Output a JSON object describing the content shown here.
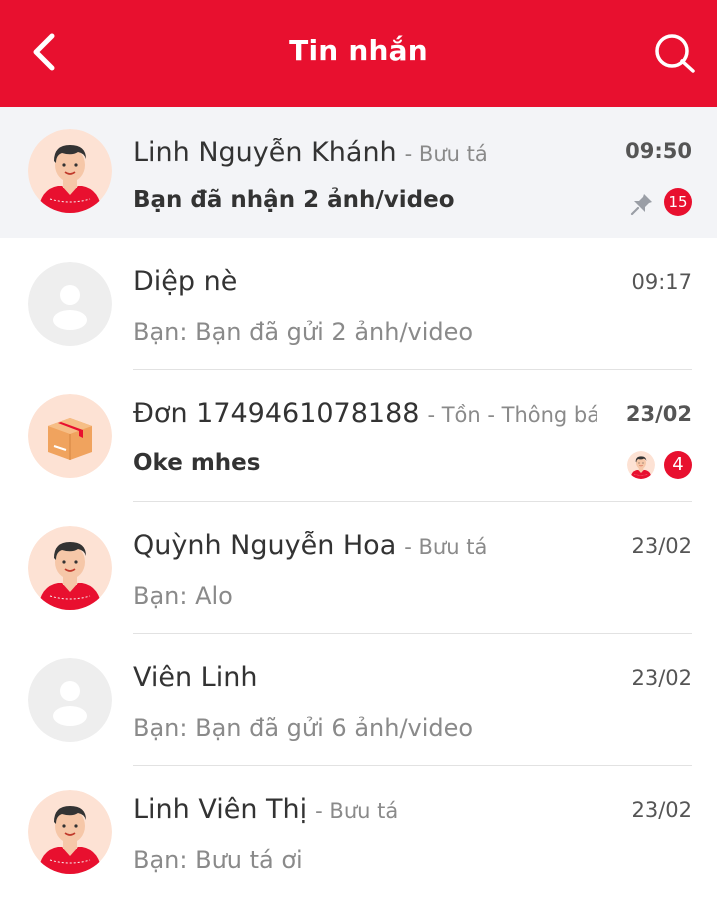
{
  "header": {
    "title": "Tin nhắn",
    "back_icon": "back-arrow-icon",
    "search_icon": "search-icon",
    "bg_color": "#e8102f"
  },
  "conversations": [
    {
      "name": "Linh Nguyễn Khánh",
      "tag": "- Bưu tá",
      "time": "09:50",
      "message": "Bạn đã nhận 2 ảnh/video",
      "avatar": "postman-avatar",
      "unread_count": "15",
      "pinned": true
    },
    {
      "name": "Diệp nè",
      "tag": "",
      "time": "09:17",
      "message": "Bạn: Bạn đã gửi 2 ảnh/video",
      "avatar": "default-avatar"
    },
    {
      "name": "Đơn 1749461078188",
      "tag": "- Tồn - Thông báo...",
      "time": "23/02",
      "message": "Oke  mhes",
      "avatar": "package-avatar",
      "unread_count": "4"
    },
    {
      "name": "Quỳnh Nguyễn Hoa",
      "tag": "- Bưu tá",
      "time": "23/02",
      "message": "Bạn: Alo",
      "avatar": "postman-avatar"
    },
    {
      "name": "Viên Linh",
      "tag": "",
      "time": "23/02",
      "message": "Bạn: Bạn đã gửi 6 ảnh/video",
      "avatar": "default-avatar"
    },
    {
      "name": "Linh Viên Thị",
      "tag": "- Bưu tá",
      "time": "23/02",
      "message": "Bạn: Bưu tá ơi",
      "avatar": "postman-avatar"
    }
  ]
}
